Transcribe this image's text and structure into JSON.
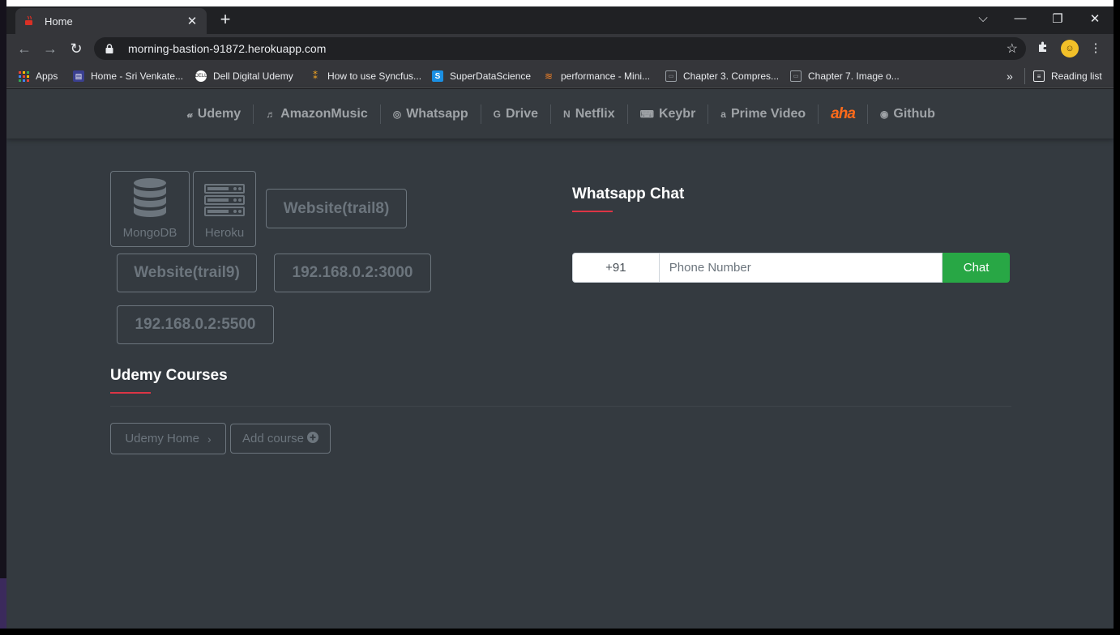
{
  "browser": {
    "tab_title": "Home",
    "url": "morning-bastion-91872.herokuapp.com",
    "bookmarks": [
      {
        "label": "Apps",
        "icon": "apps-grid-icon"
      },
      {
        "label": "Home - Sri Venkate...",
        "icon": "bookmark-favicon-icon"
      },
      {
        "label": "Dell Digital Udemy",
        "icon": "dell-icon"
      },
      {
        "label": "How to use Syncfus...",
        "icon": "syncfusion-icon"
      },
      {
        "label": "SuperDataScience",
        "icon": "superdatascience-icon"
      },
      {
        "label": "performance - Mini...",
        "icon": "stackoverflow-icon"
      },
      {
        "label": "Chapter 3. Compres...",
        "icon": "page-icon"
      },
      {
        "label": "Chapter 7. Image o...",
        "icon": "page-icon"
      }
    ],
    "reading_list": "Reading list",
    "overflow": "»"
  },
  "nav": {
    "links": [
      {
        "label": "Udemy",
        "icon": "udemy-icon"
      },
      {
        "label": "AmazonMusic",
        "icon": "music-icon"
      },
      {
        "label": "Whatsapp",
        "icon": "whatsapp-icon"
      },
      {
        "label": "Drive",
        "icon": "google-icon"
      },
      {
        "label": "Netflix",
        "icon": "netflix-icon"
      },
      {
        "label": "Keybr",
        "icon": "keyboard-icon"
      },
      {
        "label": "Prime Video",
        "icon": "amazon-icon"
      },
      {
        "label": "aha",
        "icon": "aha-logo"
      },
      {
        "label": "Github",
        "icon": "github-icon"
      }
    ]
  },
  "tiles": {
    "mongodb": "MongoDB",
    "heroku": "Heroku"
  },
  "buttons": {
    "trail8": "Website(trail8)",
    "trail9": "Website(trail9)",
    "ip3000": "192.168.0.2:3000",
    "ip5500": "192.168.0.2:5500"
  },
  "udemy": {
    "title": "Udemy Courses",
    "home": "Udemy Home",
    "add": "Add course"
  },
  "chat": {
    "title": "Whatsapp Chat",
    "country_code": "+91",
    "phone_placeholder": "Phone Number",
    "button": "Chat"
  },
  "colors": {
    "accent_red": "#dc3545",
    "chat_green": "#28a745",
    "page_bg": "#343a40",
    "aha_orange": "#ff6a1a"
  }
}
